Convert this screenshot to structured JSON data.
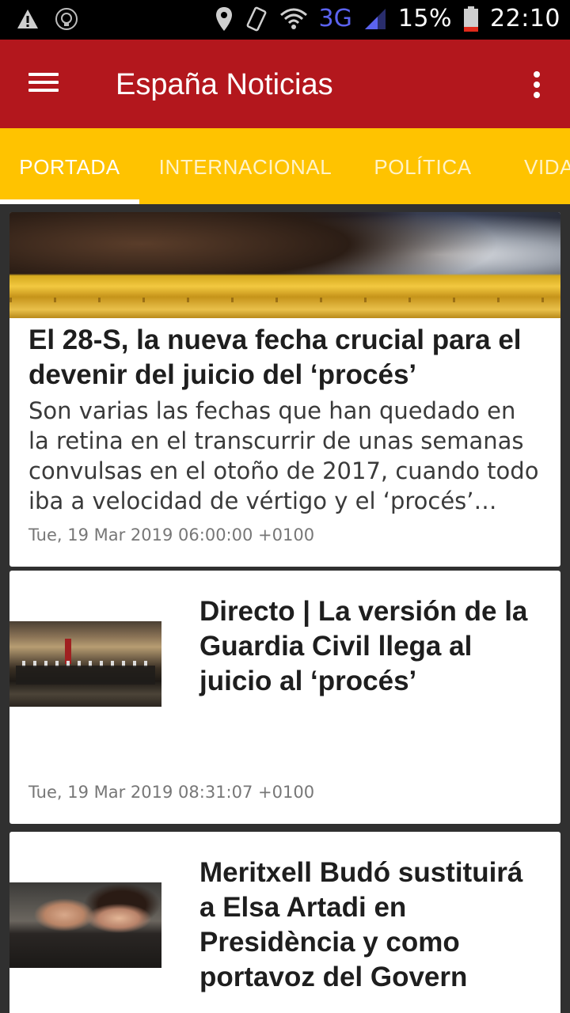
{
  "status_bar": {
    "battery": "15%",
    "network": "3G",
    "time": "22:10"
  },
  "app_bar": {
    "title": "España Noticias"
  },
  "tabs": [
    {
      "label": "PORTADA",
      "active": true
    },
    {
      "label": "INTERNACIONAL",
      "active": false
    },
    {
      "label": "POLÍTICA",
      "active": false
    },
    {
      "label": "VIDA",
      "active": false
    }
  ],
  "articles": [
    {
      "title": "El 28-S, la nueva fecha crucial para el devenir del juicio del ‘procés’",
      "description": "Son varias las fechas que han quedado en la retina en el transcurrir de unas semanas convulsas en el otoño de 2017, cuando todo iba a velocidad de vértigo y el ‘procés’ entraba",
      "date": "Tue, 19 Mar 2019 06:00:00 +0100"
    },
    {
      "title": "Directo | La versión de la Guardia Civil llega al juicio al ‘procés’",
      "date": "Tue, 19 Mar 2019 08:31:07 +0100"
    },
    {
      "title": "Meritxell Budó sustituirá a Elsa Artadi en Presidència y como portavoz del Govern"
    }
  ],
  "colors": {
    "app_bar": "#b3171d",
    "tabs_bar": "#ffc300",
    "feed_background": "#303030"
  }
}
